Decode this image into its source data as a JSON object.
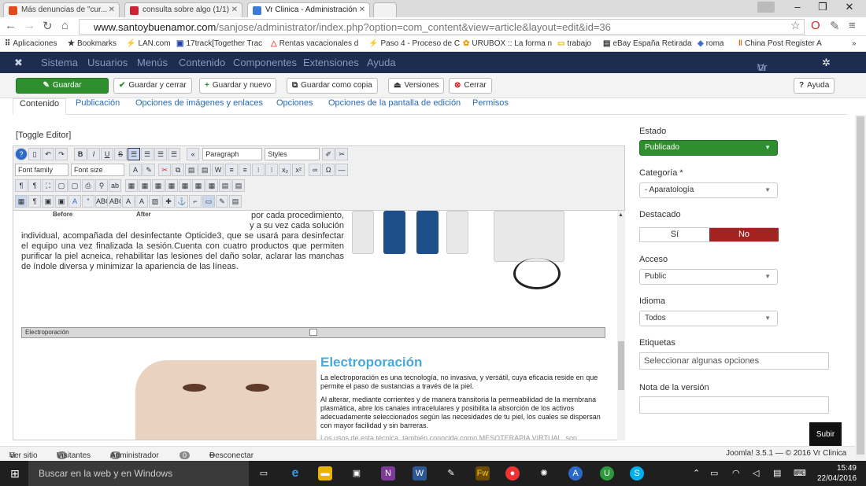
{
  "browser": {
    "tabs": [
      {
        "label": "Más denuncias de \"cur...",
        "favcolor": "#e24a1b"
      },
      {
        "label": "consulta sobre algo (1/1)",
        "favcolor": "#cc2233"
      },
      {
        "label": "Vr Clinica - Administración",
        "favcolor": "#3b7bd4"
      }
    ],
    "url_host": "www.santoybuenamor.com",
    "url_path": "/sanjose/administrator/index.php?option=com_content&view=article&layout=edit&id=36",
    "bookmarks": [
      "Aplicaciones",
      "Bookmarks",
      "LAN.com",
      "17track[Together Trac",
      "Rentas vacacionales d",
      "Paso 4 - Proceso de C",
      "URUBOX :: La forma n",
      "trabajo",
      "eBay España Retirada",
      "roma",
      "China Post Register A"
    ]
  },
  "joomla_nav": {
    "items": [
      "Sistema",
      "Usuarios",
      "Menús",
      "Contenido",
      "Componentes",
      "Extensiones",
      "Ayuda"
    ],
    "site": "Vr Clinica"
  },
  "toolbar": {
    "save": "Guardar",
    "save_close": "Guardar y cerrar",
    "save_new": "Guardar y nuevo",
    "save_copy": "Guardar como copia",
    "versions": "Versiones",
    "close": "Cerrar",
    "help": "Ayuda"
  },
  "tabs": [
    "Contenido",
    "Publicación",
    "Opciones de imágenes y enlaces",
    "Opciones",
    "Opciones de la pantalla de edición",
    "Permisos"
  ],
  "editor": {
    "toggle": "[Toggle Editor]",
    "paragraph": "Paragraph",
    "styles": "Styles",
    "font_family": "Font family",
    "font_size": "Font size",
    "before": "Before",
    "after": "After",
    "text_right": "por cada procedimiento, y a su vez cada solución",
    "text_body": "individual, acompañada del desinfectante Opticide3, que se usará para desinfectar el equipo una vez finalizada la sesión.Cuenta con cuatro productos que permiten purificar la piel acneica, rehabilitar las lesiones del daño solar, aclarar las manchas de índole diversa y minimizar la apariencia de las líneas.",
    "separator": "Electroporación",
    "heading": "Electroporación",
    "p1": "La electroporación es una tecnología, no invasiva, y versátil, cuya eficacia reside en que permite el paso de sustancias a través de la piel.",
    "p2": "Al alterar, mediante corrientes y de manera transitoria la permeabilidad de la membrana plasmática, abre los canales intracelulares y posibilita la absorción de los activos adecuadamente seleccionados según las necesidades de tu piel, los cuales se dispersan con mayor facilidad y sin barreras.",
    "p3": "Los usos de esta técnica, también conocida como MESOTERAPIA VIRTUAL, son"
  },
  "sidebar": {
    "estado_label": "Estado",
    "estado_value": "Publicado",
    "categoria_label": "Categoría *",
    "categoria_value": "- Aparatología",
    "destacado_label": "Destacado",
    "si": "Sí",
    "no": "No",
    "acceso_label": "Acceso",
    "acceso_value": "Public",
    "idioma_label": "Idioma",
    "idioma_value": "Todos",
    "etiquetas_label": "Etiquetas",
    "etiquetas_placeholder": "Seleccionar algunas opciones",
    "nota_label": "Nota de la versión",
    "nota_value": ""
  },
  "subir": "Subir",
  "status": {
    "ver_sitio": "Ver sitio",
    "visitantes_count": "0",
    "visitantes": "Visitantes",
    "admin_count": "1",
    "administrador": "Administrador",
    "msg_count": "0",
    "desconectar": "Desconectar",
    "footer": "Joomla! 3.5.1 — © 2016 Vr Clinica"
  },
  "taskbar": {
    "search": "Buscar en la web y en Windows",
    "time": "15:49",
    "date": "22/04/2016"
  },
  "colors": {
    "joomla_nav": "#1c2d4f",
    "green": "#2f8f2f",
    "red": "#a52222",
    "heading": "#4aa8d8"
  }
}
